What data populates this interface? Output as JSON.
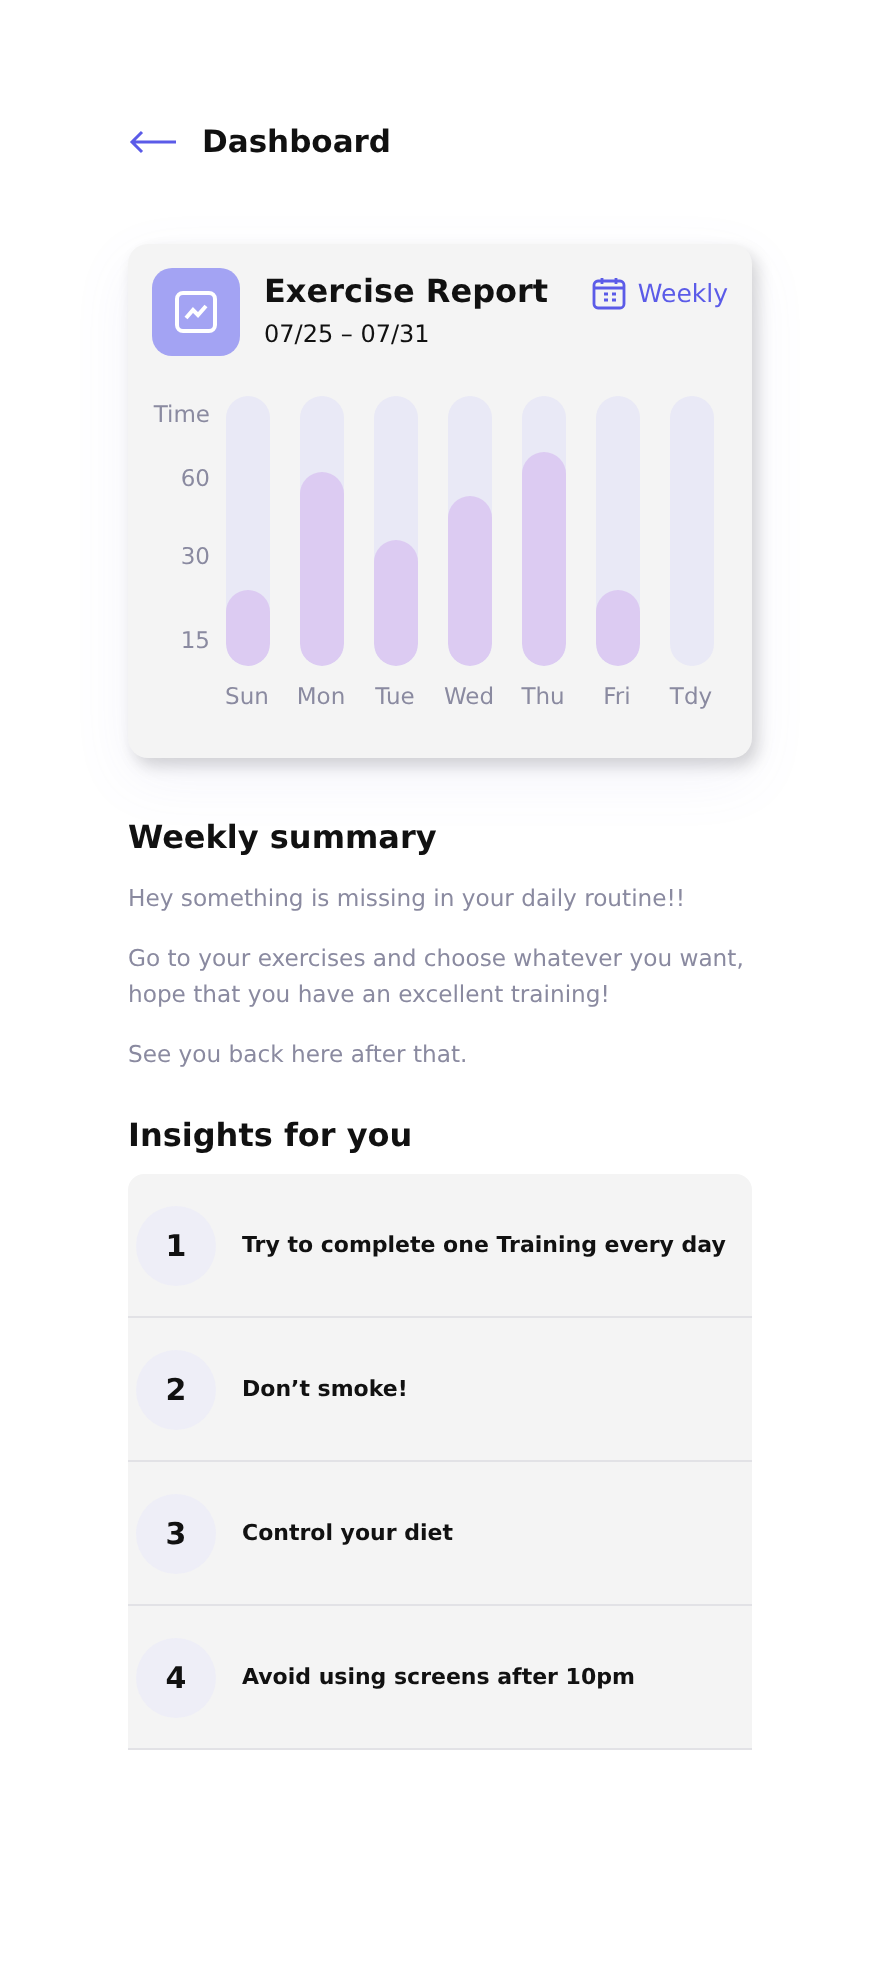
{
  "header": {
    "back_label": "Dashboard"
  },
  "report": {
    "title": "Exercise Report",
    "date_range": "07/25 – 07/31",
    "period": "Weekly",
    "axis_title": "Time",
    "axis_labels": [
      "60",
      "30",
      "15"
    ],
    "bars": [
      {
        "day": "Sun",
        "level": 0.28
      },
      {
        "day": "Mon",
        "level": 0.72
      },
      {
        "day": "Tue",
        "level": 0.47
      },
      {
        "day": "Wed",
        "level": 0.63
      },
      {
        "day": "Thu",
        "level": 0.79
      },
      {
        "day": "Fri",
        "level": 0.28
      },
      {
        "day": "Tdy"
      }
    ]
  },
  "summary": {
    "title": "Weekly summary",
    "paragraphs": [
      "Hey something is missing in your daily routine!!",
      "Go to your exercises and choose whatever you want, hope that you have an excellent training!",
      "See you back here after that."
    ]
  },
  "insights": {
    "title": "Insights for you",
    "items": [
      {
        "number": "1",
        "text": "Try to complete one Training every day"
      },
      {
        "number": "2",
        "text": "Don’t smoke!"
      },
      {
        "number": "3",
        "text": "Control your diet"
      },
      {
        "number": "4",
        "text": "Avoid using screens after 10pm"
      }
    ]
  }
}
